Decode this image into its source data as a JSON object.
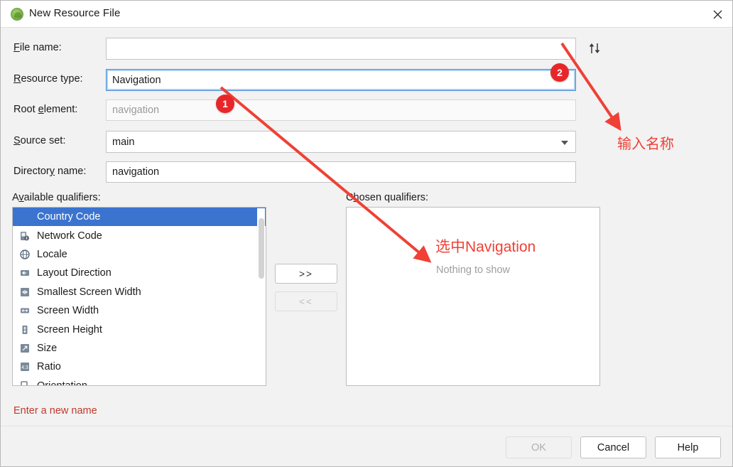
{
  "window": {
    "title": "New Resource File",
    "app_icon": "android-studio-icon",
    "close_icon": "close-icon"
  },
  "form": {
    "rows": [
      {
        "label_pre": "",
        "label_mnemonic": "F",
        "label_post": "ile name:",
        "name": "file-name",
        "value": "",
        "placeholder": ""
      },
      {
        "label_pre": "",
        "label_mnemonic": "R",
        "label_post": "esource type:",
        "name": "resource-type",
        "value": "Navigation",
        "placeholder": ""
      },
      {
        "label_pre": "Root ",
        "label_mnemonic": "e",
        "label_post": "lement:",
        "name": "root-element",
        "value": "navigation",
        "placeholder": "navigation"
      },
      {
        "label_pre": "",
        "label_mnemonic": "S",
        "label_post": "ource set:",
        "name": "source-set",
        "value": "main",
        "placeholder": ""
      },
      {
        "label_pre": "Director",
        "label_mnemonic": "y",
        "label_post": " name:",
        "name": "directory-name",
        "value": "navigation",
        "placeholder": ""
      }
    ],
    "swap_icon": "swap-up-down-icon"
  },
  "qualifiers": {
    "available_label_pre": "A",
    "available_label_mnemonic": "v",
    "available_label_post": "ailable qualifiers:",
    "chosen_label_pre": "C",
    "chosen_label_mnemonic": "h",
    "chosen_label_post": "osen qualifiers:",
    "available_items": [
      {
        "label": "Country Code",
        "icon": "country-code-icon",
        "selected": true
      },
      {
        "label": "Network Code",
        "icon": "network-code-icon",
        "selected": false
      },
      {
        "label": "Locale",
        "icon": "locale-globe-icon",
        "selected": false
      },
      {
        "label": "Layout Direction",
        "icon": "layout-direction-icon",
        "selected": false
      },
      {
        "label": "Smallest Screen Width",
        "icon": "smallest-screen-width-icon",
        "selected": false
      },
      {
        "label": "Screen Width",
        "icon": "screen-width-icon",
        "selected": false
      },
      {
        "label": "Screen Height",
        "icon": "screen-height-icon",
        "selected": false
      },
      {
        "label": "Size",
        "icon": "size-icon",
        "selected": false
      },
      {
        "label": "Ratio",
        "icon": "ratio-icon",
        "selected": false
      },
      {
        "label": "Orientation",
        "icon": "orientation-icon",
        "selected": false
      }
    ],
    "chosen_empty_text": "Nothing to show",
    "add_button": ">>",
    "remove_button": "<<"
  },
  "validation": {
    "message": "Enter a new name"
  },
  "footer": {
    "ok": "OK",
    "cancel": "Cancel",
    "help": "Help"
  },
  "annotations": {
    "badge_1": "1",
    "badge_2": "2",
    "text_right": "输入名称",
    "text_center": "选中Navigation",
    "color": "#ef4136"
  }
}
